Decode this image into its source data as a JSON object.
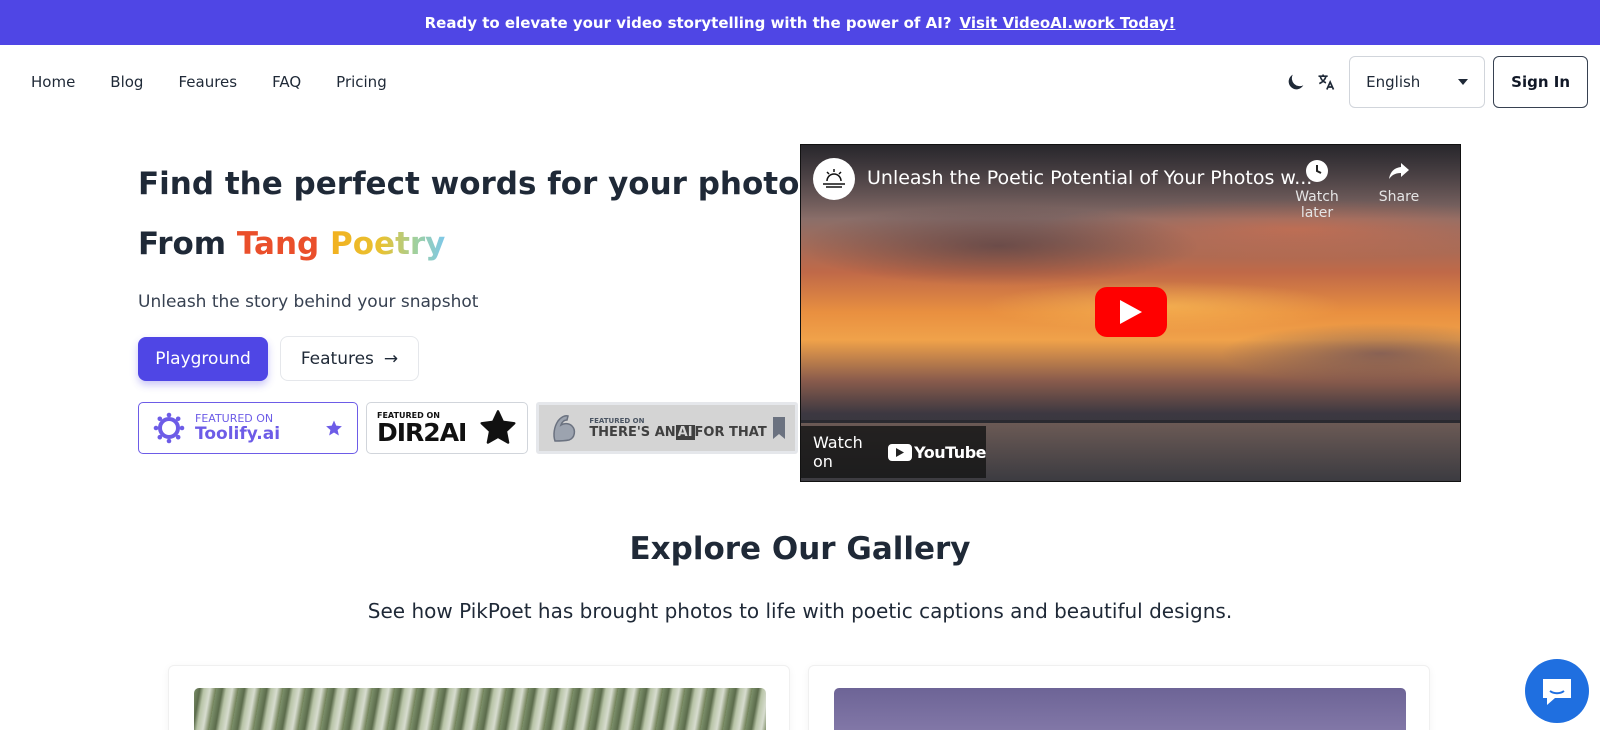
{
  "banner": {
    "text": "Ready to elevate your video storytelling with the power of AI?",
    "link_text": "Visit VideoAI.work Today!"
  },
  "nav": {
    "links": [
      "Home",
      "Blog",
      "Feaures",
      "FAQ",
      "Pricing"
    ],
    "language": "English",
    "sign_in": "Sign In",
    "icons": [
      "moon-icon",
      "translate-icon",
      "chevron-down-icon"
    ]
  },
  "hero": {
    "title": "Find the perfect words for your photos",
    "subtitle_prefix": "From",
    "subtitle_word1": "Tang",
    "subtitle_word2": "Poetry",
    "description": "Unleash the story behind your snapshot",
    "primary_button": "Playground",
    "secondary_button": "Features",
    "secondary_arrow": "→"
  },
  "badges": {
    "toolify": {
      "small": "FEATURED ON",
      "big": "Toolify.ai"
    },
    "dir2ai": {
      "small": "FEATURED ON",
      "big": "DIR2AI"
    },
    "aift": {
      "small": "FEATURED ON",
      "big_prefix": "THERE'S AN",
      "big_ai": "AI",
      "big_suffix": "FOR THAT"
    }
  },
  "video": {
    "title": "Unleash the Poetic Potential of Your Photos w...",
    "watch_later": "Watch later",
    "share": "Share",
    "watch_on": "Watch on",
    "youtube": "YouTube"
  },
  "gallery": {
    "title": "Explore Our Gallery",
    "description": "See how PikPoet has brought photos to life with poetic captions and beautiful designs."
  },
  "colors": {
    "brand": "#4f46e5",
    "tang": "#ea4f2b",
    "youtube_red": "#ff0000",
    "chat": "#1f6fe0"
  }
}
